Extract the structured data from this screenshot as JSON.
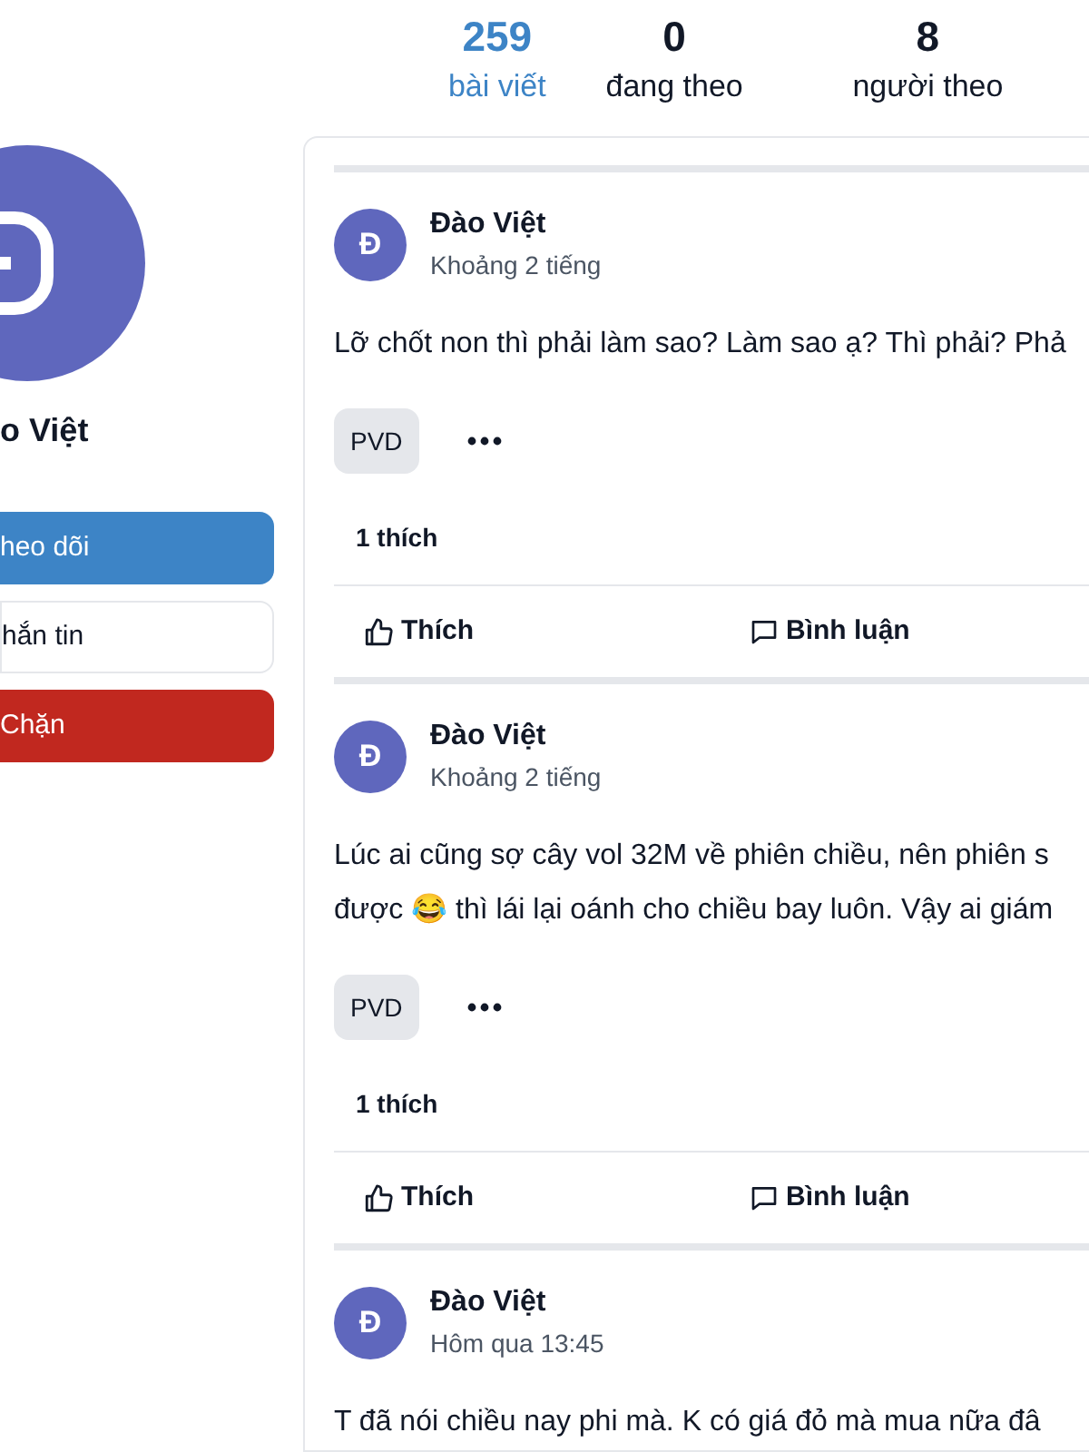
{
  "profile": {
    "name": "o Việt",
    "buttons": [
      {
        "label": "heo dõi",
        "kind": "primary"
      },
      {
        "label": "hắn tin",
        "kind": "outline"
      },
      {
        "label": "Chặn",
        "kind": "danger"
      }
    ]
  },
  "stats": [
    {
      "value": "259",
      "label": "bài viết",
      "selected": true
    },
    {
      "value": "0",
      "label": "đang theo",
      "selected": false
    },
    {
      "value": "8",
      "label": "người theo",
      "selected": false
    }
  ],
  "posts": [
    {
      "author": "Đào Việt",
      "avatar": "Đ",
      "time": "Khoảng 2 tiếng",
      "lines": [
        "Lỡ chốt non thì phải làm sao? Làm sao ạ? Thì phải? Phả"
      ],
      "tag": "PVD",
      "likes": "1 thích",
      "actions": [
        "Thích",
        "Bình luận"
      ]
    },
    {
      "author": "Đào Việt",
      "avatar": "Đ",
      "time": "Khoảng 2 tiếng",
      "lines": [
        "Lúc ai cũng sợ cây vol 32M về phiên chiều, nên phiên s",
        "được 😂 thì lái lại oánh cho chiều bay luôn. Vậy ai giám"
      ],
      "tag": "PVD",
      "likes": "1 thích",
      "actions": [
        "Thích",
        "Bình luận"
      ]
    },
    {
      "author": "Đào Việt",
      "avatar": "Đ",
      "time": "Hôm qua 13:45",
      "lines": [
        "T đã nói chiều nay phi mà. K có giá đỏ mà mua nữa đâ"
      ]
    }
  ]
}
